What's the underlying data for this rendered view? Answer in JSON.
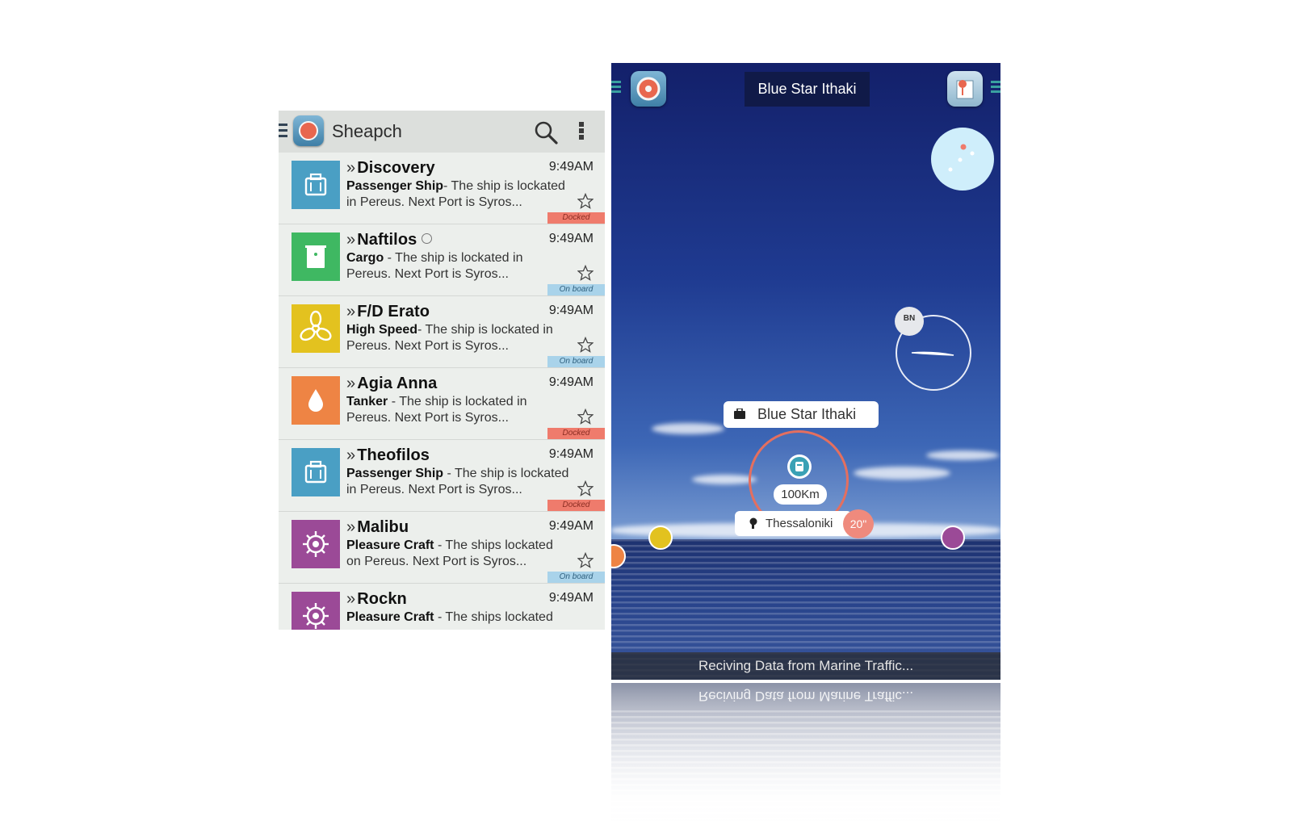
{
  "search_app": {
    "title": "Sheарch",
    "ships": [
      {
        "name": "Discovery",
        "time": "9:49AM",
        "type": "Passenger Ship",
        "sep": "- The ship is lockated",
        "line2": "in Pereus.  Next Port is Syros...",
        "status": "Docked",
        "color": "#4a9fc4",
        "icon": "luggage-icon",
        "clock": false
      },
      {
        "name": "Naftilos",
        "time": "9:49AM",
        "type": "Cargo",
        "sep": "  -  The ship is lockated in",
        "line2": "Pereus.  Next Port is Syros...",
        "status": "On board",
        "color": "#3fb862",
        "icon": "cargo-box-icon",
        "clock": true
      },
      {
        "name": "F/D Erato",
        "time": "9:49AM",
        "type": "High Speed",
        "sep": "- The ship is lockated in",
        "line2": "Pereus.  Next Port is Syros...",
        "status": "On board",
        "color": "#e3c21f",
        "icon": "propeller-icon",
        "clock": false
      },
      {
        "name": "Agia Anna",
        "time": "9:49AM",
        "type": "Tanker",
        "sep": " -  The ship is lockated in",
        "line2": "Pereus.  Next Port is Syros...",
        "status": "Docked",
        "color": "#ee8444",
        "icon": "drop-icon",
        "clock": false
      },
      {
        "name": "Theofilos",
        "time": "9:49AM",
        "type": "Passenger Ship",
        "sep": " - The ship is lockated",
        "line2": "in Pereus.  Next Port is Syros...",
        "status": "Docked",
        "color": "#4a9fc4",
        "icon": "luggage-icon",
        "clock": false
      },
      {
        "name": "Malibu",
        "time": "9:49AM",
        "type": "Pleasure Craft",
        "sep": " - The ships lockated",
        "line2": "on Pereus.  Next Port is Syros...",
        "status": "On board",
        "color": "#9b4a97",
        "icon": "helm-icon",
        "clock": false
      },
      {
        "name": "Rockn",
        "time": "9:49AM",
        "type": "Pleasure Craft",
        "sep": " - The ships lockated",
        "line2": "",
        "status": "",
        "color": "#9b4a97",
        "icon": "helm-icon",
        "clock": false
      }
    ]
  },
  "ar_view": {
    "title": "Blue Star Ithaki",
    "compass_badge": "BN",
    "ship_label": "Blue Star Ithaki",
    "distance": "100Km",
    "port": "Thessaloniki",
    "temperature": "20\"",
    "status_bar": "Reciving Data from Marine Traffic...",
    "colors": {
      "accent": "#e46f5f",
      "title_bg": "#101a48"
    }
  }
}
